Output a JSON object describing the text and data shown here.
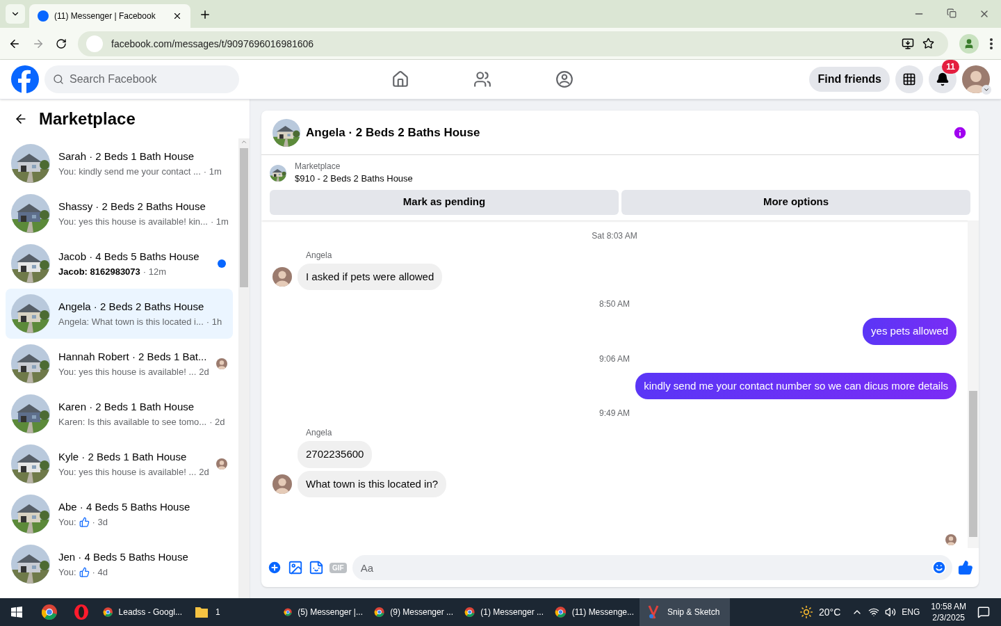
{
  "browser": {
    "tab_title": "(11) Messenger | Facebook",
    "url": "facebook.com/messages/t/9097696016981606"
  },
  "header": {
    "search_placeholder": "Search Facebook",
    "find_friends": "Find friends",
    "notification_count": "11"
  },
  "sidebar": {
    "title": "Marketplace",
    "conversations": [
      {
        "title": "Sarah · 2 Beds 1 Bath House",
        "preview": "You: kindly send me your contact ...",
        "time": " · 1m",
        "selected": false,
        "unread": false,
        "unread_dot": false,
        "seen": false,
        "like": false
      },
      {
        "title": "Shassy · 2 Beds 2 Baths House",
        "preview": "You: yes this house is available! kin...",
        "time": " · 1m",
        "selected": false,
        "unread": false,
        "unread_dot": false,
        "seen": false,
        "like": false
      },
      {
        "title": "Jacob · 4 Beds 5 Baths House",
        "preview": "Jacob: 8162983073",
        "time": " · 12m",
        "selected": false,
        "unread": true,
        "unread_dot": true,
        "seen": false,
        "like": false
      },
      {
        "title": "Angela · 2 Beds 2 Baths House",
        "preview": "Angela: What town is this located i...",
        "time": " · 1h",
        "selected": true,
        "unread": false,
        "unread_dot": false,
        "seen": false,
        "like": false
      },
      {
        "title": "Hannah Robert · 2 Beds 1 Bat...",
        "preview": "You: yes this house is available! ...",
        "time": "2d",
        "selected": false,
        "unread": false,
        "unread_dot": false,
        "seen": true,
        "like": false
      },
      {
        "title": "Karen · 2 Beds 1 Bath House",
        "preview": "Karen: Is this available to see tomo...",
        "time": " · 2d",
        "selected": false,
        "unread": false,
        "unread_dot": false,
        "seen": false,
        "like": false
      },
      {
        "title": "Kyle · 2 Beds 1 Bath House",
        "preview": "You: yes this house is available! ...",
        "time": "2d",
        "selected": false,
        "unread": false,
        "unread_dot": false,
        "seen": true,
        "like": false
      },
      {
        "title": "Abe · 4 Beds 5 Baths House",
        "preview": "You:",
        "time": " · 3d",
        "selected": false,
        "unread": false,
        "unread_dot": false,
        "seen": false,
        "like": true
      },
      {
        "title": "Jen · 4 Beds 5 Baths House",
        "preview": "You:",
        "time": " · 4d",
        "selected": false,
        "unread": false,
        "unread_dot": false,
        "seen": false,
        "like": true
      }
    ]
  },
  "chat": {
    "title": "Angela · 2 Beds 2 Baths House",
    "listing_label": "Marketplace",
    "listing": "$910 - 2 Beds 2 Baths House",
    "buttons": [
      "Mark as pending",
      "More options"
    ],
    "messages": [
      {
        "kind": "time",
        "text": "Sat 8:03 AM"
      },
      {
        "kind": "incoming",
        "sender": "Angela",
        "texts": [
          "I asked if pets were allowed"
        ]
      },
      {
        "kind": "time",
        "text": "8:50 AM"
      },
      {
        "kind": "outgoing",
        "texts": [
          "yes pets allowed"
        ]
      },
      {
        "kind": "time",
        "text": "9:06 AM"
      },
      {
        "kind": "outgoing",
        "texts": [
          "kindly send me your contact number so we can dicus more details"
        ]
      },
      {
        "kind": "time",
        "text": "9:49 AM"
      },
      {
        "kind": "incoming",
        "sender": "Angela",
        "texts": [
          "2702235600",
          "What town is this located in?"
        ]
      }
    ],
    "composer_placeholder": "Aa",
    "gif_label": "GIF"
  },
  "taskbar": {
    "items": [
      {
        "kind": "chrome",
        "selected": false
      },
      {
        "kind": "opera",
        "selected": false
      },
      {
        "kind": "chrome",
        "label": "Leadss - Googl...",
        "selected": false
      },
      {
        "kind": "folder",
        "label": "1",
        "selected": false
      },
      {
        "kind": "chrome",
        "label": "(5) Messenger |...",
        "selected": false
      },
      {
        "kind": "chrome",
        "label": "(9) Messenger ...",
        "selected": false
      },
      {
        "kind": "chrome",
        "label": "(1) Messenger ...",
        "selected": false
      },
      {
        "kind": "chrome",
        "label": "(11) Messenge...",
        "selected": false
      },
      {
        "kind": "snip",
        "label": "Snip & Sketch",
        "selected": true
      }
    ],
    "weather": "20°C",
    "language": "ENG",
    "time": "10:58 AM",
    "date": "2/3/2025"
  }
}
